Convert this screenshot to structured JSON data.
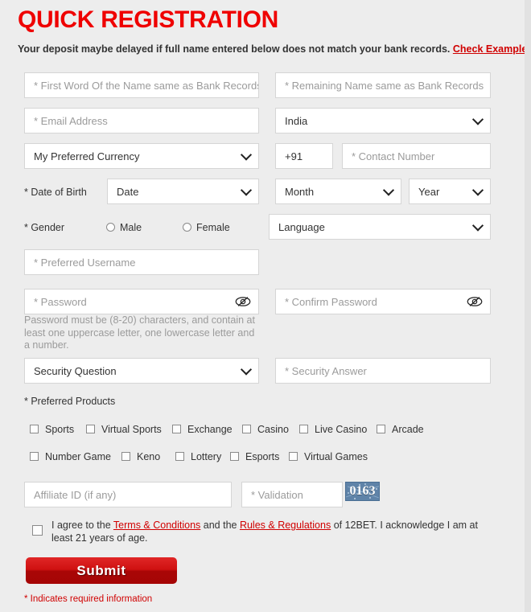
{
  "header": {
    "title": "QUICK REGISTRATION",
    "notice_text": "Your deposit maybe delayed if full name entered below does not match your bank records.",
    "notice_link": "Check Example"
  },
  "fields": {
    "first_name_placeholder": "* First Word Of the Name same as Bank Records",
    "last_name_placeholder": "* Remaining Name same as Bank Records",
    "email_placeholder": "* Email Address",
    "country_value": "India",
    "currency_value": "My Preferred Currency",
    "phone_prefix": "+91",
    "contact_placeholder": "* Contact Number",
    "dob_label": "* Date of Birth",
    "dob_day": "Date",
    "dob_month": "Month",
    "dob_year": "Year",
    "gender_label": "* Gender",
    "gender_male": "Male",
    "gender_female": "Female",
    "language_value": "Language",
    "username_placeholder": "* Preferred Username",
    "password_placeholder": "* Password",
    "confirm_password_placeholder": "* Confirm Password",
    "password_hint": "Password must be (8-20) characters, and contain at least one uppercase letter, one lowercase letter and a number.",
    "security_question_value": "Security Question",
    "security_answer_placeholder": "* Security Answer",
    "affiliate_placeholder": "Affiliate ID (if any)",
    "validation_placeholder": "* Validation",
    "captcha_code": "0163"
  },
  "products": {
    "label": "* Preferred Products",
    "row1": [
      "Sports",
      "Virtual Sports",
      "Exchange",
      "Casino",
      "Live Casino",
      "Arcade"
    ],
    "row2": [
      "Number Game",
      "Keno",
      "Lottery",
      "Esports",
      "Virtual Games"
    ]
  },
  "terms": {
    "part1": "I agree to the ",
    "link1": "Terms & Conditions",
    "part2": " and the ",
    "link2": "Rules & Regulations",
    "part3": " of 12BET. I acknowledge I am at least 21 years of age."
  },
  "submit": {
    "label": "Submit"
  },
  "footer": {
    "required_note": "* Indicates required information"
  },
  "colors": {
    "brand_red": "#ef0000",
    "link_red": "#d00000",
    "page_bg": "#ededed",
    "captcha_bg": "#5f83a8"
  }
}
